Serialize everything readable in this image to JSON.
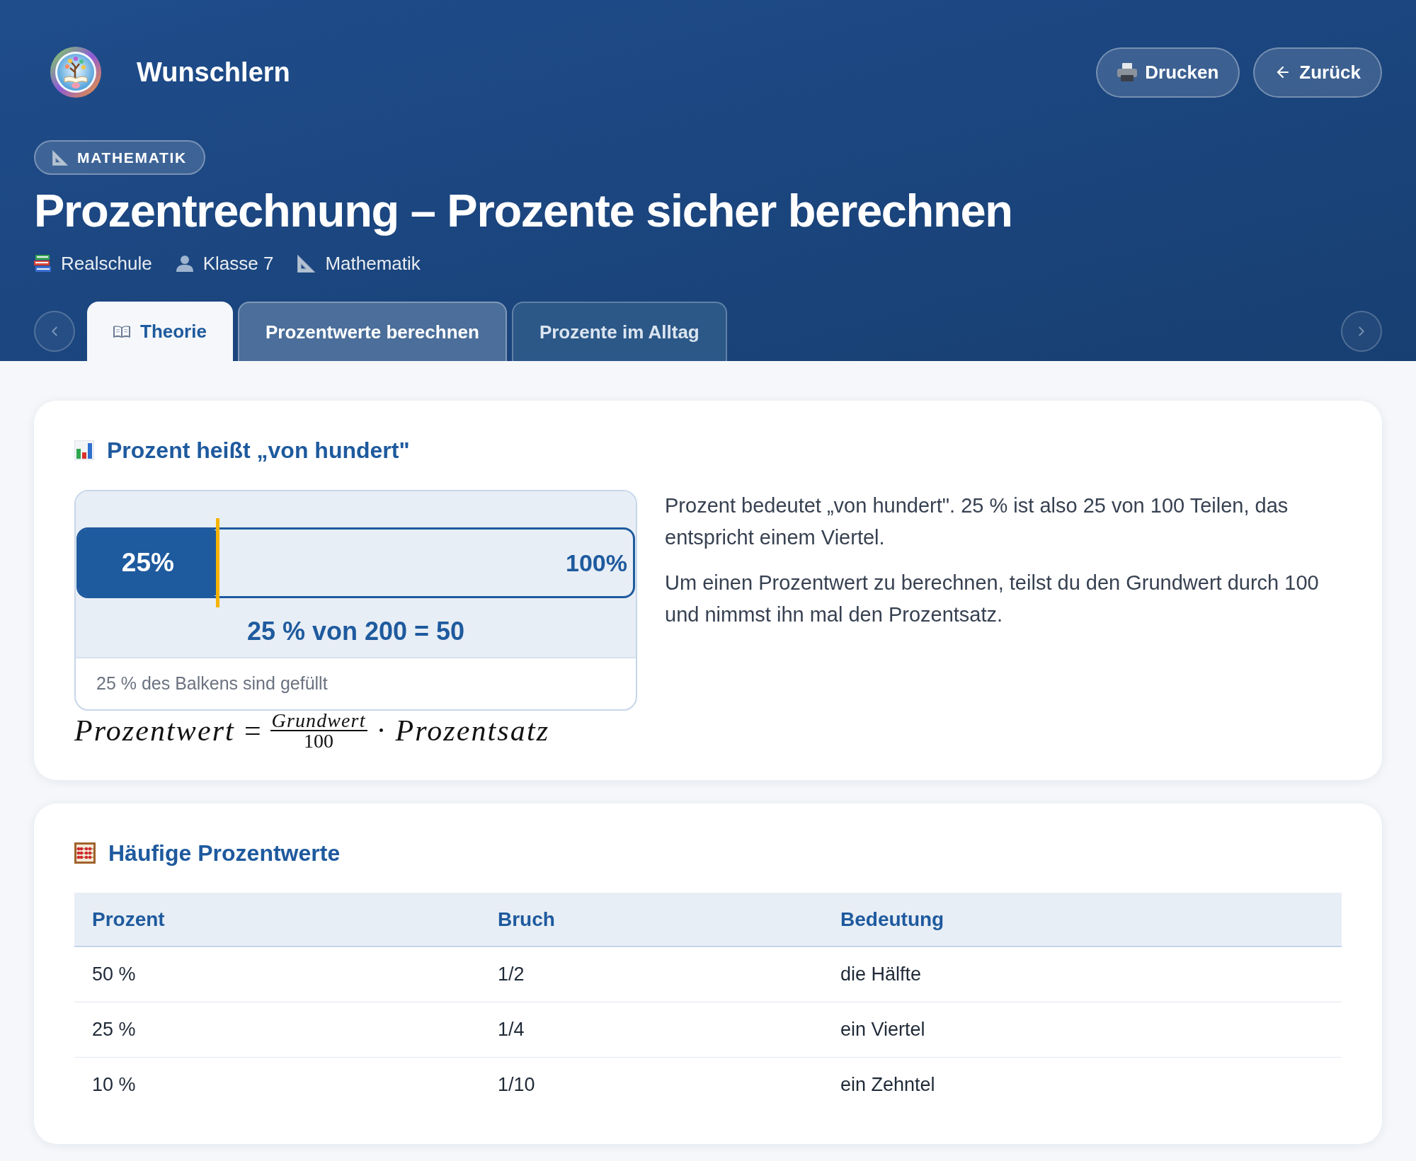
{
  "header": {
    "site_title": "Wunschlern",
    "buttons": [
      {
        "kind": "print",
        "label": "Drucken"
      },
      {
        "kind": "back",
        "label": "Zurück"
      }
    ]
  },
  "subject_badge": "MATHEMATIK",
  "title": "Prozentrechnung – Prozente sicher berechnen",
  "meta": [
    {
      "kind": "school",
      "label": "Realschule"
    },
    {
      "kind": "grade",
      "label": "Klasse 7"
    },
    {
      "kind": "subject",
      "label": "Mathematik"
    }
  ],
  "tabs": [
    {
      "kind": "icon",
      "label": "Theorie",
      "selected": true,
      "hovered": false
    },
    {
      "kind": "plain",
      "label": "Prozentwerte berechnen",
      "selected": false,
      "hovered": true
    },
    {
      "kind": "plain",
      "label": "Prozente im Alltag",
      "selected": false,
      "hovered": false
    }
  ],
  "cards": [
    {
      "kind": "visual",
      "heading": "Prozent heißt „von hundert\"",
      "bar": {
        "level": 0.25,
        "fill_label": "25%",
        "end_label": "100%",
        "equation": "25 % von 200 = 50",
        "caption": "25 % des Balkens sind gefüllt"
      },
      "formula": {
        "lhs": "Prozentwert",
        "equals": "=",
        "numerator": "Grundwert",
        "denominator": "100",
        "times": "·",
        "factor": "Prozentsatz"
      },
      "paragraphs": [
        "Prozent bedeutet „von hundert\". 25 % ist also 25 von 100 Teilen, das entspricht einem Viertel.",
        "Um einen Prozentwert zu berechnen, teilst du den Grundwert durch 100 und nimmst ihn mal den Prozentsatz."
      ]
    },
    {
      "kind": "table",
      "heading": "Häufige Prozentwerte",
      "table": {
        "columns": [
          "Prozent",
          "Bruch",
          "Bedeutung"
        ],
        "rows": [
          [
            "50 %",
            "1/2",
            "die Hälfte"
          ],
          [
            "25 %",
            "1/4",
            "ein Viertel"
          ],
          [
            "10 %",
            "1/10",
            "ein Zehntel"
          ]
        ]
      }
    }
  ]
}
